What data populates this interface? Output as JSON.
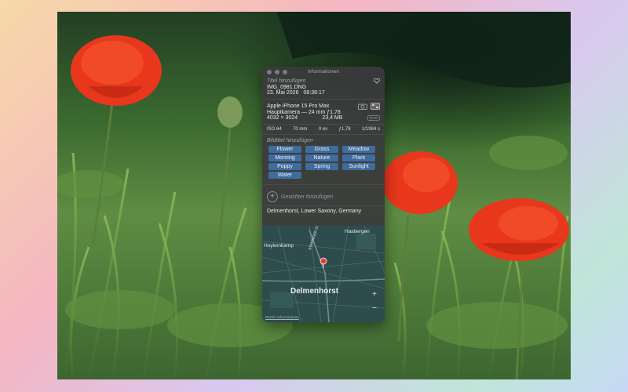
{
  "panel": {
    "window_title": "Informationen",
    "add_title_placeholder": "Titel hinzufügen",
    "filename": "IMG_0981.DNG",
    "date": "23. Mai 2026",
    "time": "08:36:17",
    "device": "Apple iPhone 15 Pro Max",
    "lens": "Hauptkamera — 24 mm ƒ1,78",
    "resolution": "4032 × 3024",
    "file_size": "23,4 MB",
    "raw_badge": "RAW",
    "exif": {
      "iso": "ISO 64",
      "focal": "70 mm",
      "exposure": "0 ev",
      "aperture": "ƒ1,78",
      "shutter": "1/1984 s"
    },
    "caption_placeholder": "Bildtitel hinzufügen",
    "tags": [
      "Flower",
      "Grass",
      "Meadow",
      "Morning",
      "Nature",
      "Plant",
      "Poppy",
      "Spring",
      "Sunlight",
      "Water"
    ],
    "add_face_label": "Gesichter hinzufügen",
    "location": "Delmenhorst, Lower Saxony, Germany",
    "map": {
      "labels": {
        "hasbergen": "Hasbergen",
        "hoykenkamp": "Hoykenkamp",
        "stedinger": "STEDINGER STRASSE",
        "city": "Delmenhorst"
      },
      "legal": "Rechtl. Informationen",
      "zoom_in": "+",
      "zoom_out": "−"
    }
  },
  "colors": {
    "tag_bg": "#3f6b9e",
    "poppy_red": "#e8371c",
    "map_bg": "#2e4c4e",
    "pin": "#e0403a"
  }
}
